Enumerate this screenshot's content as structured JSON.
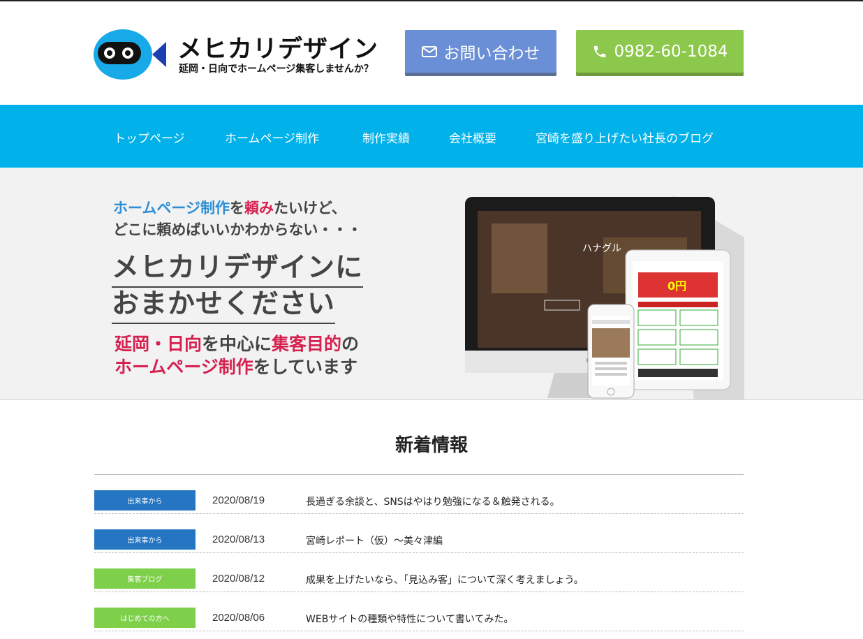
{
  "brand": {
    "title": "メヒカリデザイン",
    "tagline": "延岡・日向でホームページ集客しませんか？"
  },
  "header": {
    "contact_label": "お問い合わせ",
    "phone_label": "0982-60-1084"
  },
  "nav": {
    "items": [
      {
        "label": "トップページ"
      },
      {
        "label": "ホームページ制作"
      },
      {
        "label": "制作実績"
      },
      {
        "label": "会社概要"
      },
      {
        "label": "宮崎を盛り上げたい社長のブログ"
      }
    ]
  },
  "hero": {
    "line1_a": "ホームページ制作",
    "line1_b": "を",
    "line1_c": "頼み",
    "line1_d": "たいけど、",
    "line2": "どこに頼めばいいかわからない・・・",
    "big_line1": "メヒカリデザインに",
    "big_line2": "おまかせください",
    "line5_a": "延岡・日向",
    "line5_b": "を中心に",
    "line5_c": "集客目的",
    "line5_d": "の",
    "line6_a": "ホームページ制作",
    "line6_b": "をしています"
  },
  "news": {
    "title": "新着情報",
    "items": [
      {
        "category": "出来事から",
        "date": "2020/08/19",
        "text": "長過ぎる余談と、SNSはやはり勉強になる＆触発される。",
        "color": "#2475c2"
      },
      {
        "category": "出来事から",
        "date": "2020/08/13",
        "text": "宮崎レポート（仮）～美々津編",
        "color": "#2475c2"
      },
      {
        "category": "集客ブログ",
        "date": "2020/08/12",
        "text": "成果を上げたいなら、「見込み客」について深く考えましょう。",
        "color": "#7ed04a"
      },
      {
        "category": "はじめての方へ",
        "date": "2020/08/06",
        "text": "WEBサイトの種類や特性について書いてみた。",
        "color": "#7ed04a"
      }
    ]
  },
  "colors": {
    "nav_bg": "#00b1ea",
    "contact_btn": "#6b8fd6",
    "phone_btn": "#8cc84b",
    "accent_blue": "#2d8fd6",
    "accent_red": "#d6204f"
  },
  "icons": {
    "contact": "envelope-icon",
    "phone": "phone-icon",
    "logo": "fish-mascot-icon"
  }
}
